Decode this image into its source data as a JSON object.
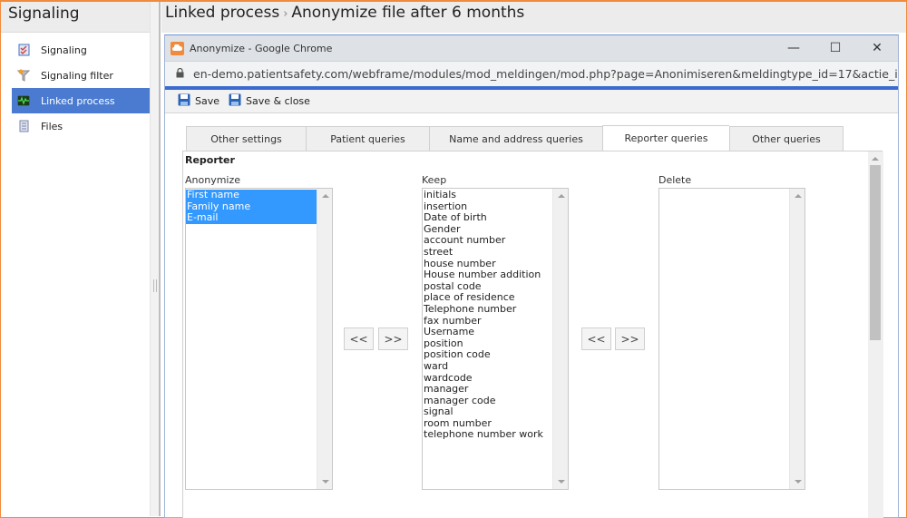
{
  "app": {
    "left_header": "Signaling",
    "breadcrumb": {
      "parent": "Linked process",
      "separator": "›",
      "current": "Anonymize file after 6 months"
    },
    "sidebar": {
      "items": [
        {
          "label": "Signaling",
          "icon": "checklist-icon",
          "active": false
        },
        {
          "label": "Signaling filter",
          "icon": "funnel-icon",
          "active": false
        },
        {
          "label": "Linked process",
          "icon": "process-icon",
          "active": true
        },
        {
          "label": "Files",
          "icon": "files-icon",
          "active": false
        }
      ]
    }
  },
  "popup": {
    "window_title": "Anonymize - Google Chrome",
    "url": "en-demo.patientsafety.com/webframe/modules/mod_meldingen/mod.php?page=Anonimiseren&meldingtype_id=17&actie_id...",
    "controls": {
      "minimize": "—",
      "maximize": "☐",
      "close": "✕"
    },
    "toolbar": {
      "save_label": "Save",
      "save_close_label": "Save & close"
    },
    "tabs": [
      {
        "label": "Other settings",
        "active": false
      },
      {
        "label": "Patient queries",
        "active": false
      },
      {
        "label": "Name and address queries",
        "active": false
      },
      {
        "label": "Reporter queries",
        "active": true
      },
      {
        "label": "Other queries",
        "active": false
      }
    ],
    "section_title": "Reporter",
    "columns": {
      "anonymize": {
        "label": "Anonymize",
        "items": [
          "First name",
          "Family name",
          "E-mail"
        ],
        "selected": [
          "First name",
          "Family name",
          "E-mail"
        ]
      },
      "keep": {
        "label": "Keep",
        "items": [
          "initials",
          "insertion",
          "Date of birth",
          "Gender",
          "account number",
          "street",
          "house number",
          "House number addition",
          "postal code",
          "place of residence",
          "Telephone number",
          "fax number",
          "Username",
          "position",
          "position code",
          "ward",
          "wardcode",
          "manager",
          "manager code",
          "signal",
          "room number",
          "telephone number work"
        ]
      },
      "delete": {
        "label": "Delete",
        "items": []
      }
    },
    "move_buttons": {
      "left": "<<",
      "right": ">>"
    }
  }
}
